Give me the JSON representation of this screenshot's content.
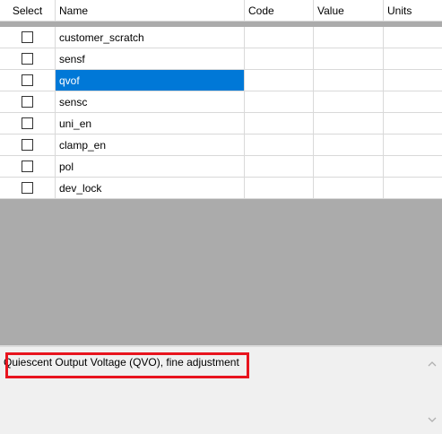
{
  "table": {
    "headers": [
      "Select",
      "Name",
      "Code",
      "Value",
      "Units"
    ],
    "rows": [
      {
        "name": "customer_scratch",
        "code": "",
        "value": "",
        "units": "",
        "checked": false,
        "selected": false
      },
      {
        "name": "sensf",
        "code": "",
        "value": "",
        "units": "",
        "checked": false,
        "selected": false
      },
      {
        "name": "qvof",
        "code": "",
        "value": "",
        "units": "",
        "checked": false,
        "selected": true
      },
      {
        "name": "sensc",
        "code": "",
        "value": "",
        "units": "",
        "checked": false,
        "selected": false
      },
      {
        "name": "uni_en",
        "code": "",
        "value": "",
        "units": "",
        "checked": false,
        "selected": false
      },
      {
        "name": "clamp_en",
        "code": "",
        "value": "",
        "units": "",
        "checked": false,
        "selected": false
      },
      {
        "name": "pol",
        "code": "",
        "value": "",
        "units": "",
        "checked": false,
        "selected": false
      },
      {
        "name": "dev_lock",
        "code": "",
        "value": "",
        "units": "",
        "checked": false,
        "selected": false
      }
    ]
  },
  "description": {
    "text": "Quiescent Output Voltage (QVO), fine adjustment"
  },
  "colors": {
    "selection": "#0078d7",
    "highlight_box": "#e8141e",
    "empty_grid": "#ababab"
  },
  "icons": {
    "scroll_up": "chevron-up-icon",
    "scroll_down": "chevron-down-icon"
  }
}
